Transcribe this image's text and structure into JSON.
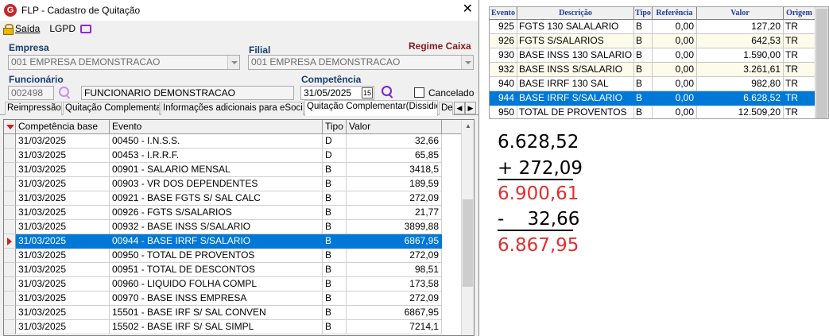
{
  "window": {
    "title": "FLP - Cadastro de Quitação",
    "logo_letter": "G",
    "close_glyph": "✕"
  },
  "menu": {
    "saida": "Saída",
    "lgpd": "LGPD"
  },
  "form": {
    "empresa_label": "Empresa",
    "empresa_value": "001 EMPRESA DEMONSTRACAO",
    "filial_label": "Filial",
    "filial_value": "001 EMPRESA DEMONSTRACAO",
    "regime_label": "Regime Caixa",
    "funcionario_label": "Funcionário",
    "funcionario_code": "002498",
    "funcionario_name": "FUNCIONARIO DEMONSTRACAO",
    "competencia_label": "Competência",
    "competencia_value": "31/05/2025",
    "calendar_glyph": "15",
    "cancelado_label": "Cancelado"
  },
  "tabs": [
    "Reimpressão",
    "Quitação Complementar",
    "Informações adicionais para eSocial",
    "Quitação Complementar(Dissidio)",
    "De"
  ],
  "grid": {
    "columns": [
      "Competência base",
      "Evento",
      "Tipo",
      "Valor"
    ],
    "selected_row": 7,
    "rows": [
      [
        "31/03/2025",
        "00450 - I.N.S.S.",
        "D",
        "32,66"
      ],
      [
        "31/03/2025",
        "00453 - I.R.R.F.",
        "D",
        "65,85"
      ],
      [
        "31/03/2025",
        "00901 - SALARIO MENSAL",
        "B",
        "3418,5"
      ],
      [
        "31/03/2025",
        "00903 - VR DOS DEPENDENTES",
        "B",
        "189,59"
      ],
      [
        "31/03/2025",
        "00921 - BASE FGTS S/ SAL CALC",
        "B",
        "272,09"
      ],
      [
        "31/03/2025",
        "00926 - FGTS S/SALARIOS",
        "B",
        "21,77"
      ],
      [
        "31/03/2025",
        "00932 - BASE INSS S/SALARIO",
        "B",
        "3899,88"
      ],
      [
        "31/03/2025",
        "00944 - BASE IRRF S/SALARIO",
        "B",
        "6867,95"
      ],
      [
        "31/03/2025",
        "00950 - TOTAL DE PROVENTOS",
        "B",
        "272,09"
      ],
      [
        "31/03/2025",
        "00951 - TOTAL DE DESCONTOS",
        "B",
        "98,51"
      ],
      [
        "31/03/2025",
        "00960 - LIQUIDO FOLHA COMPL",
        "B",
        "173,58"
      ],
      [
        "31/03/2025",
        "00970 - BASE INSS EMPRESA",
        "B",
        "272,09"
      ],
      [
        "31/03/2025",
        "15501 - BASE IRF S/ SAL CONVEN",
        "B",
        "6867,95"
      ],
      [
        "31/03/2025",
        "15502 - BASE IRF S/ SAL SIMPL",
        "B",
        "7214,1"
      ]
    ]
  },
  "right_grid": {
    "columns": [
      "Evento",
      "Descrição",
      "Tipo",
      "Referência",
      "Valor",
      "Origem"
    ],
    "selected_row": 5,
    "rows": [
      [
        "925",
        "FGTS 130 SALALARIO",
        "B",
        "0,00",
        "127,20",
        "TR"
      ],
      [
        "926",
        "FGTS S/SALARIOS",
        "B",
        "0,00",
        "642,53",
        "TR"
      ],
      [
        "930",
        "BASE INSS 130 SALARIO",
        "B",
        "0,00",
        "1.590,00",
        "TR"
      ],
      [
        "932",
        "BASE INSS S/SALARIO",
        "B",
        "0,00",
        "3.261,61",
        "TR"
      ],
      [
        "940",
        "BASE IRRF 130 SAL",
        "B",
        "0,00",
        "982,80",
        "TR"
      ],
      [
        "944",
        "BASE IRRF S/SALARIO",
        "B",
        "0,00",
        "6.628,52",
        "TR"
      ],
      [
        "950",
        "TOTAL DE PROVENTOS",
        "B",
        "0,00",
        "12.509,20",
        "TR"
      ]
    ]
  },
  "calculation": {
    "line1": "6.628,52",
    "line2": "+ 272,09",
    "line3": "6.900,61",
    "line4": "-    32,66",
    "line5": "6.867,95",
    "result_color": "#e03030"
  }
}
